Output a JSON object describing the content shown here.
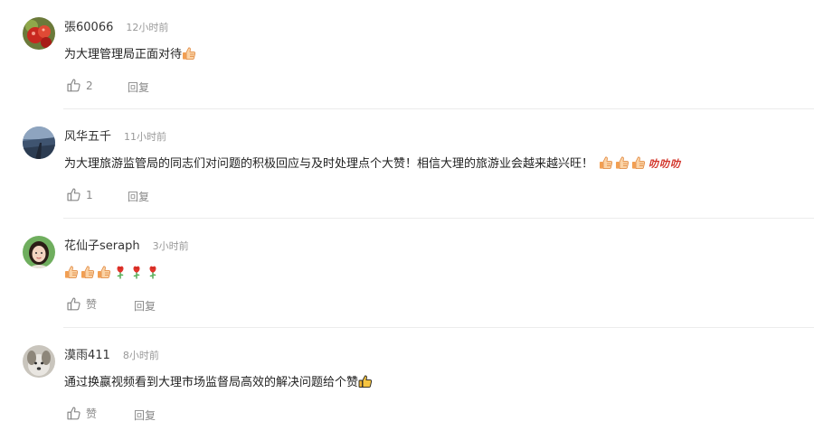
{
  "comments": [
    {
      "user": "張60066",
      "time": "12小时前",
      "text": "为大理管理局正面对待",
      "trailing_emojis": [
        "thumbs-up-icon"
      ],
      "like_count": "2",
      "reply_label": "回复",
      "avatar": "red-fruit-photo"
    },
    {
      "user": "风华五千",
      "time": "11小时前",
      "text": "为大理旅游监管局的同志们对问题的积极回应与及时处理点个大赞！相信大理的旅游业会越来越兴旺！",
      "trailing_emojis": [
        "thumbs-up-icon",
        "thumbs-up-icon",
        "thumbs-up-icon",
        "hao-text-icon",
        "hao-text-icon",
        "hao-text-icon"
      ],
      "emoji_text": "叻",
      "like_count": "1",
      "reply_label": "回复",
      "avatar": "lake-road-photo"
    },
    {
      "user": "花仙子seraph",
      "time": "3小时前",
      "text": "",
      "trailing_emojis": [
        "thumbs-up-icon",
        "thumbs-up-icon",
        "thumbs-up-icon",
        "rose-icon",
        "rose-icon",
        "rose-icon"
      ],
      "like_label": "赞",
      "reply_label": "回复",
      "avatar": "woman-portrait"
    },
    {
      "user": "漠雨411",
      "time": "8小时前",
      "text": "通过换嬴视频看到大理市场监督局高效的解决问题给个赞",
      "trailing_emojis": [
        "thumbs-up-black-icon"
      ],
      "like_label": "赞",
      "reply_label": "回复",
      "avatar": "dog-photo"
    }
  ],
  "colors": {
    "name": "#333333",
    "meta": "#999999",
    "action": "#888888",
    "divider": "#ececec"
  }
}
